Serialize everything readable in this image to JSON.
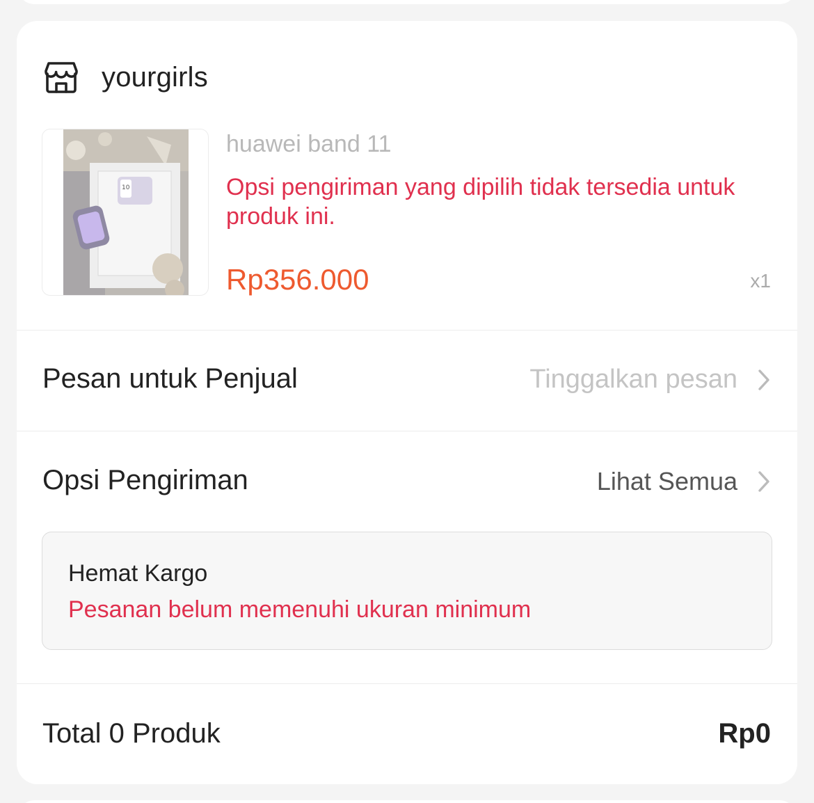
{
  "shop": {
    "name": "yourgirls",
    "icon": "store-icon"
  },
  "product": {
    "name": "huawei band 11",
    "error": "Opsi pengiriman yang dipilih tidak tersedia untuk produk ini.",
    "price": "Rp356.000",
    "quantity": "x1",
    "image": "product-photo-huawei-band-box"
  },
  "message_row": {
    "label": "Pesan untuk Penjual",
    "placeholder": "Tinggalkan pesan",
    "icon": "chevron-right-icon"
  },
  "shipping_row": {
    "label": "Opsi Pengiriman",
    "action": "Lihat Semua",
    "icon": "chevron-right-icon"
  },
  "cargo": {
    "title": "Hemat Kargo",
    "warning": "Pesanan belum memenuhi ukuran minimum"
  },
  "total": {
    "label": "Total 0 Produk",
    "value": "Rp0"
  },
  "colors": {
    "error_red": "#e0304e",
    "price_orange": "#ee5a2f",
    "muted_gray": "#b8b8b8",
    "background": "#f4f4f4"
  }
}
